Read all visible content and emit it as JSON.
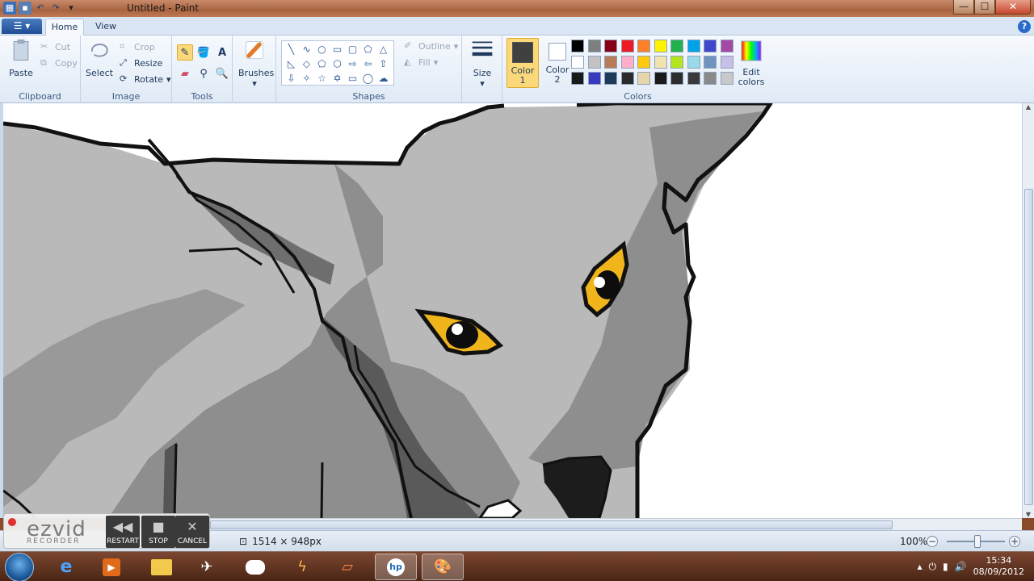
{
  "window": {
    "title": "Untitled - Paint",
    "buttons": {
      "minimize": "—",
      "maximize": "☐",
      "close": "✕"
    }
  },
  "tabs": {
    "app_menu": "☰ ▾",
    "home": "Home",
    "view": "View",
    "help": "?"
  },
  "ribbon": {
    "clipboard": {
      "label": "Clipboard",
      "paste": "Paste",
      "cut": "Cut",
      "copy": "Copy"
    },
    "image": {
      "label": "Image",
      "select": "Select",
      "crop": "Crop",
      "resize": "Resize",
      "rotate": "Rotate"
    },
    "tools": {
      "label": "Tools"
    },
    "brushes": {
      "label": "Brushes"
    },
    "shapes": {
      "label": "Shapes",
      "outline": "Outline",
      "fill": "Fill"
    },
    "size": {
      "label": "Size"
    },
    "colors": {
      "label": "Colors",
      "color1": "Color 1",
      "color2": "Color 2",
      "edit": "Edit colors",
      "color1_value": "#404040",
      "color2_value": "#ffffff",
      "palette_row1": [
        "#000000",
        "#7f7f7f",
        "#880015",
        "#ed1c24",
        "#ff7f27",
        "#fff200",
        "#22b14c",
        "#00a2e8",
        "#3f48cc",
        "#a349a4"
      ],
      "palette_row2": [
        "#ffffff",
        "#c3c3c3",
        "#b97a57",
        "#ffaec9",
        "#ffc90e",
        "#efe4b0",
        "#b5e61d",
        "#99d9ea",
        "#7092be",
        "#c8bfe7"
      ],
      "palette_row3": [
        "#1a1a1a",
        "#3a3ac0",
        "#1d3a5a",
        "#2a2a2a",
        "#e6d5a8",
        "#1a1a1a",
        "#2c2c2c",
        "#3a3a3a",
        "#8a8a8a",
        "#c9c9c9"
      ]
    }
  },
  "status": {
    "dimensions": "1514 × 948px",
    "zoom": "100%"
  },
  "ezvid": {
    "logo": "ezvid",
    "sub": "RECORDER",
    "restart": "RESTART",
    "stop": "STOP",
    "cancel": "CANCEL"
  },
  "taskbar": {
    "time": "15:34",
    "date": "08/09/2012"
  }
}
